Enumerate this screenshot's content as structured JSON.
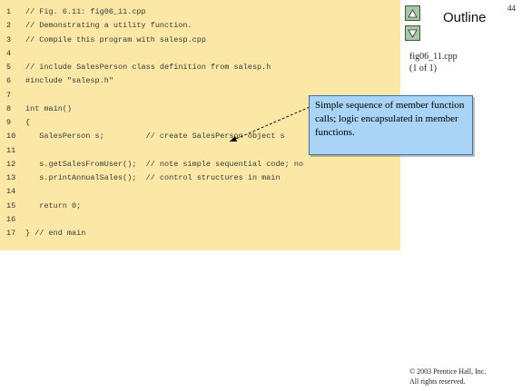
{
  "slide_number": "44",
  "outline": {
    "title": "Outline",
    "up_icon": "triangle-up-icon",
    "down_icon": "triangle-down-icon"
  },
  "caption": {
    "file": "fig06_11.cpp",
    "page": "(1 of 1)"
  },
  "code": [
    {
      "num": "1",
      "text": "// Fig. 6.11: fig06_11.cpp"
    },
    {
      "num": "2",
      "text": "// Demonstrating a utility function."
    },
    {
      "num": "3",
      "text": "// Compile this program with salesp.cpp"
    },
    {
      "num": "4",
      "text": ""
    },
    {
      "num": "5",
      "text": "// include SalesPerson class definition from salesp.h"
    },
    {
      "num": "6",
      "text": "#include \"salesp.h\""
    },
    {
      "num": "7",
      "text": ""
    },
    {
      "num": "8",
      "text": "int main()"
    },
    {
      "num": "9",
      "text": "{"
    },
    {
      "num": "10",
      "text": "   SalesPerson s;         // create SalesPerson object s"
    },
    {
      "num": "11",
      "text": ""
    },
    {
      "num": "12",
      "text": "   s.getSalesFromUser();  // note simple sequential code; no"
    },
    {
      "num": "13",
      "text": "   s.printAnnualSales();  // control structures in main"
    },
    {
      "num": "14",
      "text": ""
    },
    {
      "num": "15",
      "text": "   return 0;"
    },
    {
      "num": "16",
      "text": ""
    },
    {
      "num": "17",
      "text": "} // end main"
    }
  ],
  "callout": {
    "text": "Simple sequence of member function calls; logic encapsulated in member functions."
  },
  "copyright": {
    "line1": "© 2003 Prentice Hall, Inc.",
    "line2": "All rights reserved."
  },
  "colors": {
    "code_background": "#fbe8a6",
    "callout_background": "#a9d4f5",
    "nav_button": "#a8c6a8"
  }
}
